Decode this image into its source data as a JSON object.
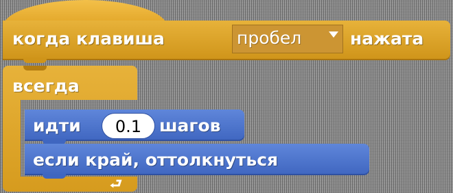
{
  "blocks": {
    "when_key_pressed": {
      "prefix": "когда клавиша",
      "key": "пробел",
      "suffix": "нажата",
      "color": "#e1a91a"
    },
    "forever": {
      "label": "всегда",
      "loop_symbol": "⮐",
      "color": "#e1a91a"
    },
    "move_steps": {
      "prefix": "идти",
      "steps": "0.1",
      "suffix": "шагов",
      "color": "#4a6cd4"
    },
    "bounce": {
      "label": "если край, оттолкнуться",
      "color": "#4a6cd4"
    }
  }
}
